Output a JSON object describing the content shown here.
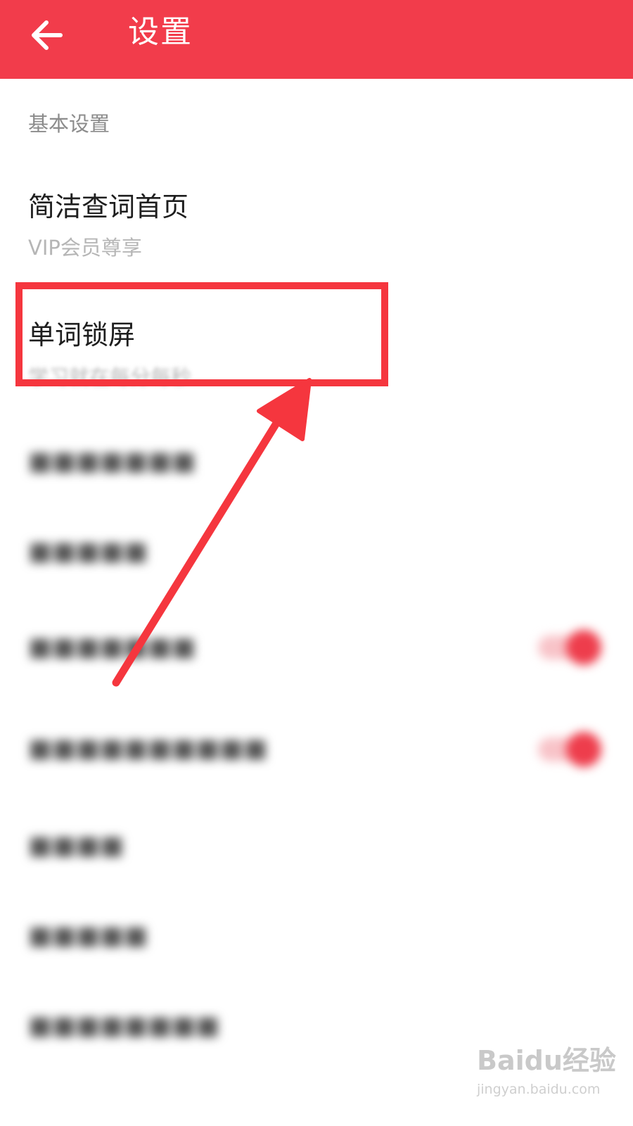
{
  "header": {
    "title": "设置",
    "back_icon": "arrow-left-icon"
  },
  "section": {
    "title": "基本设置"
  },
  "items": [
    {
      "title": "简洁查词首页",
      "subtitle": "VIP会员尊享"
    },
    {
      "title": "单词锁屏",
      "subtitle": "学习就在每分每秒"
    }
  ],
  "blurred_rows": [
    {
      "type": "text"
    },
    {
      "type": "text"
    },
    {
      "type": "toggle",
      "on": true
    },
    {
      "type": "toggle",
      "on": true
    },
    {
      "type": "text"
    },
    {
      "type": "text"
    },
    {
      "type": "text"
    }
  ],
  "colors": {
    "accent": "#f23c4b",
    "annotation": "#f5363e"
  },
  "watermark": {
    "brand": "Baidu经验",
    "url": "jingyan.baidu.com"
  }
}
